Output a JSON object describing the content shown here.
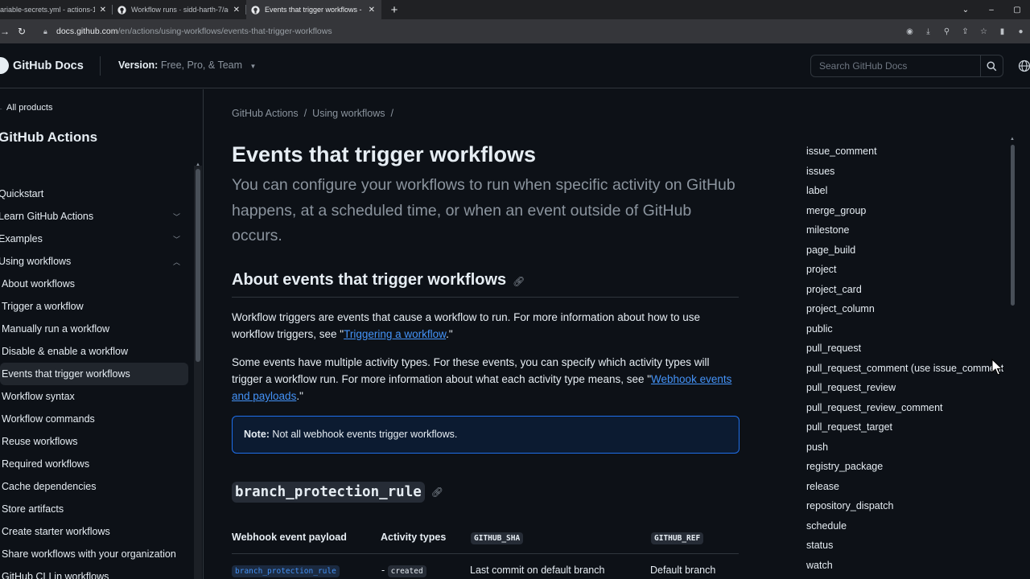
{
  "browser": {
    "tabs": [
      {
        "title": "ariable-secrets.yml - actions-1",
        "active": false
      },
      {
        "title": "Workflow runs · sidd-harth-7/ac",
        "active": false
      },
      {
        "title": "Events that trigger workflows - G",
        "active": true
      }
    ],
    "url_host": "docs.github.com",
    "url_path": "/en/actions/using-workflows/events-that-trigger-workflows"
  },
  "header": {
    "brand": "GitHub Docs",
    "version_label": "Version:",
    "version_value": "Free, Pro, & Team",
    "search_placeholder": "Search GitHub Docs"
  },
  "sidebar": {
    "all_products": "All products",
    "product_title": "GitHub Actions",
    "items": [
      {
        "label": "Quickstart",
        "level": "top"
      },
      {
        "label": "Learn GitHub Actions",
        "level": "top",
        "chevron": "down"
      },
      {
        "label": "Examples",
        "level": "top",
        "chevron": "down"
      },
      {
        "label": "Using workflows",
        "level": "top",
        "chevron": "up"
      },
      {
        "label": "About workflows",
        "level": "child"
      },
      {
        "label": "Trigger a workflow",
        "level": "child"
      },
      {
        "label": "Manually run a workflow",
        "level": "child"
      },
      {
        "label": "Disable & enable a workflow",
        "level": "child"
      },
      {
        "label": "Events that trigger workflows",
        "level": "child",
        "active": true
      },
      {
        "label": "Workflow syntax",
        "level": "child"
      },
      {
        "label": "Workflow commands",
        "level": "child"
      },
      {
        "label": "Reuse workflows",
        "level": "child"
      },
      {
        "label": "Required workflows",
        "level": "child"
      },
      {
        "label": "Cache dependencies",
        "level": "child"
      },
      {
        "label": "Store artifacts",
        "level": "child"
      },
      {
        "label": "Create starter workflows",
        "level": "child"
      },
      {
        "label": "Share workflows with your organization",
        "level": "child"
      },
      {
        "label": "GitHub CLI in workflows",
        "level": "child"
      }
    ]
  },
  "main": {
    "breadcrumbs": [
      "GitHub Actions",
      "Using workflows"
    ],
    "title": "Events that trigger workflows",
    "intro": "You can configure your workflows to run when specific activity on GitHub happens, at a scheduled time, or when an event outside of GitHub occurs.",
    "section_heading": "About events that trigger workflows",
    "p1_text": "Workflow triggers are events that cause a workflow to run. For more information about how to use workflow triggers, see \"",
    "p1_link": "Triggering a workflow",
    "p1_end": ".\"",
    "p2_text": "Some events have multiple activity types. For these events, you can specify which activity types will trigger a workflow run. For more information about what each activity type means, see \"",
    "p2_link": "Webhook events and payloads",
    "p2_end": ".\"",
    "note_label": "Note:",
    "note_text": " Not all webhook events trigger workflows.",
    "event_heading": "branch_protection_rule",
    "table": {
      "headers": [
        "Webhook event payload",
        "Activity types",
        "GITHUB_SHA",
        "GITHUB_REF"
      ],
      "row": {
        "payload": "branch_protection_rule",
        "activity_prefix": "- ",
        "activity": "created",
        "sha": "Last commit on default branch",
        "ref": "Default branch"
      }
    }
  },
  "toc": [
    "issue_comment",
    "issues",
    "label",
    "merge_group",
    "milestone",
    "page_build",
    "project",
    "project_card",
    "project_column",
    "public",
    "pull_request",
    "pull_request_comment (use issue_comment)",
    "pull_request_review",
    "pull_request_review_comment",
    "pull_request_target",
    "push",
    "registry_package",
    "release",
    "repository_dispatch",
    "schedule",
    "status",
    "watch"
  ],
  "colors": {
    "bg": "#0d1117",
    "link": "#4493f8",
    "border": "#30363d",
    "muted": "#8b949e"
  }
}
